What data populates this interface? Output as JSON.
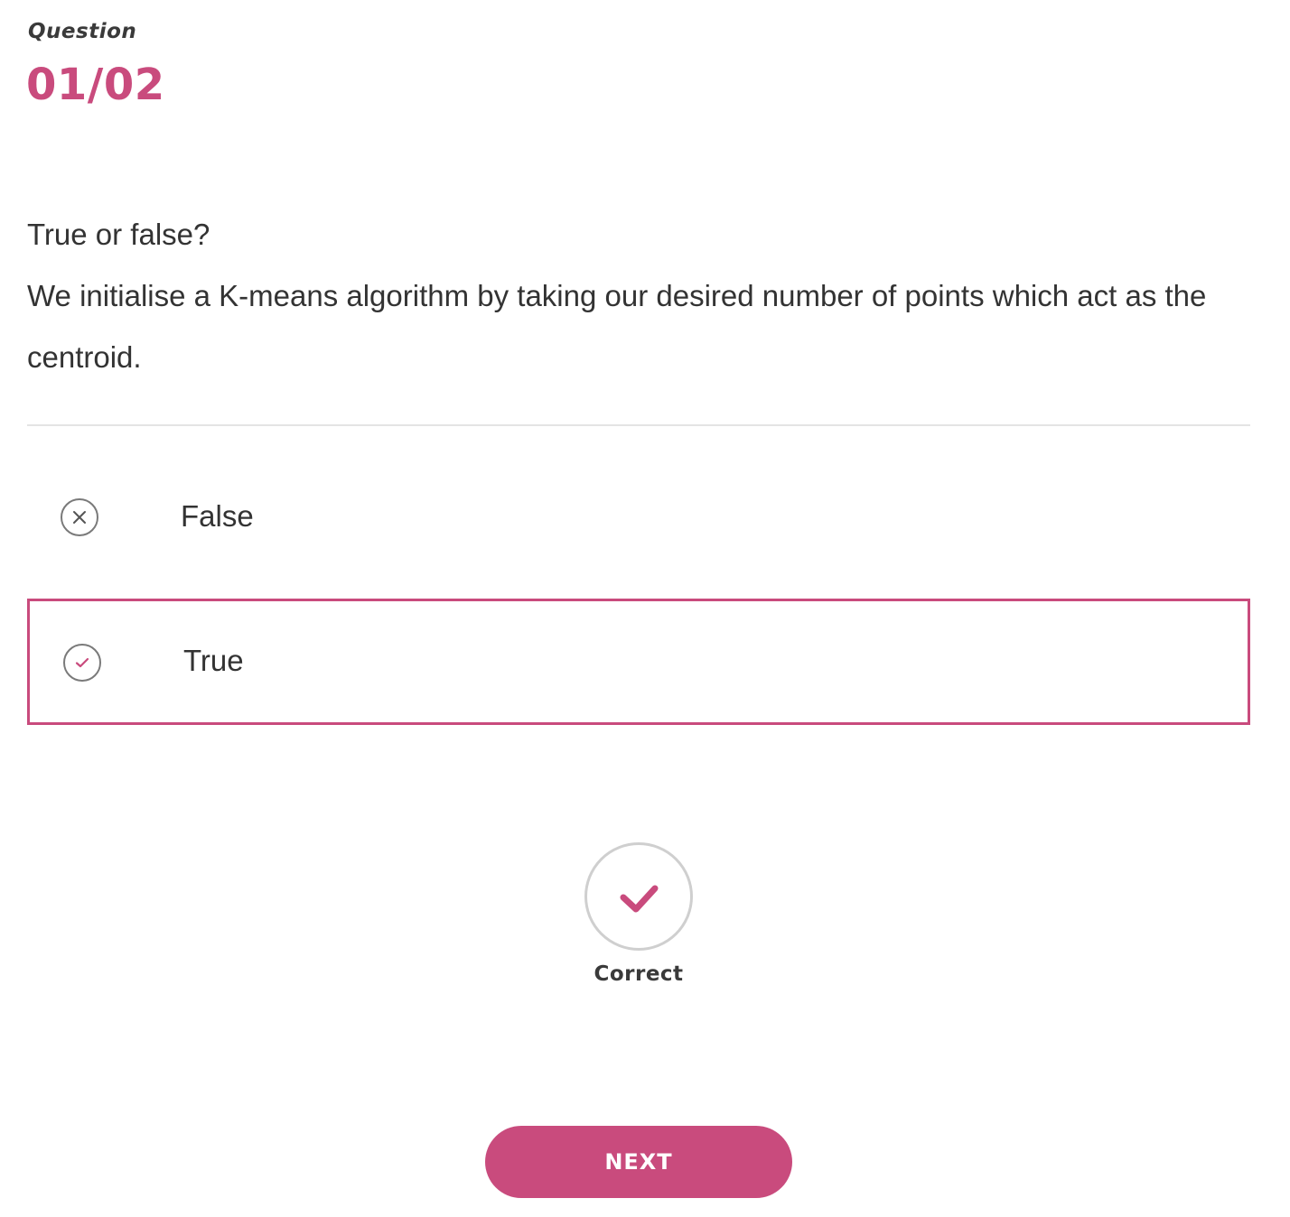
{
  "header": {
    "label": "Question",
    "number": "01/02"
  },
  "question": {
    "line1": "True or false?",
    "line2": "We initialise a K-means algorithm by taking our desired number of points which act as the centroid."
  },
  "options": [
    {
      "label": "False",
      "icon": "close-circle-icon",
      "selected": false
    },
    {
      "label": "True",
      "icon": "check-circle-icon",
      "selected": true
    }
  ],
  "result": {
    "icon": "check-icon",
    "text": "Correct"
  },
  "next_button": {
    "label": "NEXT"
  },
  "colors": {
    "accent": "#c94b7d",
    "text": "#333333",
    "icon_border": "#7a7a7a",
    "divider": "#e4e4e4"
  }
}
